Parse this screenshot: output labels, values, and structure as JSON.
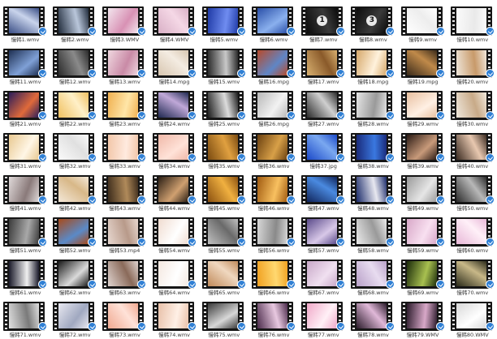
{
  "files": [
    {
      "name": "慢韩1.wmv",
      "colors": [
        "#3a4e86",
        "#c9d4ec"
      ]
    },
    {
      "name": "慢韩2.wmv",
      "colors": [
        "#1f2a3a",
        "#b9c6da"
      ]
    },
    {
      "name": "慢韩3.WMV",
      "colors": [
        "#f3e6ee",
        "#d891b4"
      ]
    },
    {
      "name": "慢韩4.WMV",
      "colors": [
        "#d9b0c6",
        "#f5d8e6"
      ]
    },
    {
      "name": "慢韩5.wmv",
      "colors": [
        "#1f3aa6",
        "#6f8cf0"
      ]
    },
    {
      "name": "慢韩6.wmv",
      "colors": [
        "#2a4fa8",
        "#8ab0ee"
      ]
    },
    {
      "name": "慢韩7.wmv",
      "colors": [
        "#0c0c0c",
        "#3a3a3a"
      ],
      "mark": "1"
    },
    {
      "name": "慢韩8.wmv",
      "colors": [
        "#0c0c0c",
        "#3a3a3a"
      ],
      "mark": "3"
    },
    {
      "name": "慢韩9.wmv",
      "colors": [
        "#ffffff",
        "#ededed"
      ]
    },
    {
      "name": "慢韩10.wmv",
      "colors": [
        "#fbfbfb",
        "#e9e9e9"
      ]
    },
    {
      "name": "慢韩11.wmv",
      "colors": [
        "#1e2f52",
        "#7fa0d6"
      ]
    },
    {
      "name": "慢韩12.wmv",
      "colors": [
        "#2a2a2a",
        "#8a8a8a"
      ]
    },
    {
      "name": "慢韩13.wmv",
      "colors": [
        "#f0d8e0",
        "#c98aa6"
      ]
    },
    {
      "name": "慢韩14.mpg",
      "colors": [
        "#d8c6b0",
        "#f4ece2"
      ]
    },
    {
      "name": "慢韩15.wmv",
      "colors": [
        "#2a2a2a",
        "#c8c8c8"
      ]
    },
    {
      "name": "慢韩16.mpg",
      "colors": [
        "#b84a2a",
        "#5f86c6"
      ]
    },
    {
      "name": "慢韩17.wmv",
      "colors": [
        "#d8b070",
        "#8a5a2a"
      ]
    },
    {
      "name": "慢韩18.mpg",
      "colors": [
        "#d6a86a",
        "#fff2dc"
      ]
    },
    {
      "name": "慢韩19.mpg",
      "colors": [
        "#3a2a1a",
        "#c08a4a"
      ]
    },
    {
      "name": "慢韩20.wmv",
      "colors": [
        "#efe6da",
        "#c89a6a"
      ]
    },
    {
      "name": "慢韩21.wmv",
      "colors": [
        "#2a1c5a",
        "#e06a3a"
      ]
    },
    {
      "name": "慢韩22.wmv",
      "colors": [
        "#f0c060",
        "#fff0c8"
      ]
    },
    {
      "name": "慢韩23.wmv",
      "colors": [
        "#f0b050",
        "#ffe6a8"
      ]
    },
    {
      "name": "慢韩24.wmv",
      "colors": [
        "#1e2850",
        "#c0a8d8"
      ]
    },
    {
      "name": "慢韩25.wmv",
      "colors": [
        "#1a1a1a",
        "#dcdcdc"
      ]
    },
    {
      "name": "慢韩26.mpg",
      "colors": [
        "#b8b8b8",
        "#f2f2f2"
      ]
    },
    {
      "name": "慢韩27.wmv",
      "colors": [
        "#2a2a2a",
        "#cfcfcf"
      ]
    },
    {
      "name": "慢韩28.wmv",
      "colors": [
        "#e6e6e6",
        "#9a9a9a"
      ]
    },
    {
      "name": "慢韩29.wmv",
      "colors": [
        "#e8c0a0",
        "#fff0e4"
      ]
    },
    {
      "name": "慢韩30.wmv",
      "colors": [
        "#f0e8dc",
        "#c8aa88"
      ]
    },
    {
      "name": "慢韩31.wmv",
      "colors": [
        "#e8c890",
        "#fff6e6"
      ]
    },
    {
      "name": "慢韩32.wmv",
      "colors": [
        "#fafafa",
        "#e0e0e0"
      ]
    },
    {
      "name": "慢韩33.wmv",
      "colors": [
        "#f2c6a8",
        "#ffeadf"
      ]
    },
    {
      "name": "慢韩34.wmv",
      "colors": [
        "#f0b8a8",
        "#ffe2d8"
      ]
    },
    {
      "name": "慢韩35.wmv",
      "colors": [
        "#7a4a10",
        "#e0a040"
      ]
    },
    {
      "name": "慢韩36.wmv",
      "colors": [
        "#6a4010",
        "#d8a048"
      ]
    },
    {
      "name": "慢韩37.jpg",
      "colors": [
        "#1a48c8",
        "#7aa8f0"
      ]
    },
    {
      "name": "慢韩38.wmv",
      "colors": [
        "#1a2a7a",
        "#3a78e0"
      ]
    },
    {
      "name": "慢韩39.wmv",
      "colors": [
        "#2a1a14",
        "#c89a7a"
      ]
    },
    {
      "name": "慢韩40.wmv",
      "colors": [
        "#3a2a20",
        "#e8c8b0"
      ]
    },
    {
      "name": "慢韩41.wmv",
      "colors": [
        "#e0dada",
        "#8a7a7a"
      ]
    },
    {
      "name": "慢韩42.wmv",
      "colors": [
        "#f4e8d8",
        "#d8b888"
      ]
    },
    {
      "name": "慢韩43.wmv",
      "colors": [
        "#3a2a1a",
        "#b08a5a"
      ]
    },
    {
      "name": "慢韩44.wmv",
      "colors": [
        "#2a1e14",
        "#d0a070"
      ]
    },
    {
      "name": "慢韩45.wmv",
      "colors": [
        "#8a5010",
        "#f0b040"
      ]
    },
    {
      "name": "慢韩46.wmv",
      "colors": [
        "#a05a10",
        "#f8c060"
      ]
    },
    {
      "name": "慢韩47.wmv",
      "colors": [
        "#10245a",
        "#4a8ae0"
      ]
    },
    {
      "name": "慢韩48.wmv",
      "colors": [
        "#1a2a6a",
        "#e8e8f0"
      ]
    },
    {
      "name": "慢韩49.wmv",
      "colors": [
        "#9a9a9a",
        "#e6e6e6"
      ]
    },
    {
      "name": "慢韩50.wmv",
      "colors": [
        "#2a2a2a",
        "#b8b8b8"
      ]
    },
    {
      "name": "慢韩51.wmv",
      "colors": [
        "#3a3a3a",
        "#a8a8a8"
      ]
    },
    {
      "name": "慢韩52.wmv",
      "colors": [
        "#a84a1a",
        "#5a8ac8"
      ]
    },
    {
      "name": "慢韩53.mp4",
      "colors": [
        "#e8d8d0",
        "#b89a8a"
      ]
    },
    {
      "name": "慢韩54.wmv",
      "colors": [
        "#f0dcd0",
        "#ffffff"
      ]
    },
    {
      "name": "慢韩55.wmv",
      "colors": [
        "#c0c0c0",
        "#6a6a6a"
      ]
    },
    {
      "name": "慢韩56.wmv",
      "colors": [
        "#d8d8d8",
        "#8a8a8a"
      ]
    },
    {
      "name": "慢韩57.wmv",
      "colors": [
        "#5a4a8a",
        "#d8c8e8"
      ]
    },
    {
      "name": "慢韩58.wmv",
      "colors": [
        "#ececec",
        "#9a9a9a"
      ]
    },
    {
      "name": "慢韩59.wmv",
      "colors": [
        "#d8a8c8",
        "#f8e0f0"
      ]
    },
    {
      "name": "慢韩60.wmv",
      "colors": [
        "#e8b8d8",
        "#fff0f8"
      ]
    },
    {
      "name": "慢韩61.wmv",
      "colors": [
        "#1a1a2a",
        "#f0f0f0"
      ]
    },
    {
      "name": "慢韩62.wmv",
      "colors": [
        "#1a1a1a",
        "#dadada"
      ]
    },
    {
      "name": "慢韩63.wmv",
      "colors": [
        "#e0d4d0",
        "#8a6a5a"
      ]
    },
    {
      "name": "慢韩64.wmv",
      "colors": [
        "#f4e8e0",
        "#ffffff"
      ]
    },
    {
      "name": "慢韩65.wmv",
      "colors": [
        "#c08a5a",
        "#f0d8c0"
      ]
    },
    {
      "name": "慢韩66.wmv",
      "colors": [
        "#f0a020",
        "#ffd870"
      ]
    },
    {
      "name": "慢韩67.wmv",
      "colors": [
        "#c8a8c8",
        "#f0e0f0"
      ]
    },
    {
      "name": "慢韩68.wmv",
      "colors": [
        "#b8a0c8",
        "#e8dcf0"
      ]
    },
    {
      "name": "慢韩69.wmv",
      "colors": [
        "#1a2a0a",
        "#a8c050"
      ]
    },
    {
      "name": "慢韩70.wmv",
      "colors": [
        "#2a2a1a",
        "#c8b888"
      ]
    },
    {
      "name": "慢韩71.wmv",
      "colors": [
        "#e0e0e0",
        "#7a7a7a"
      ]
    },
    {
      "name": "慢韩72.wmv",
      "colors": [
        "#e8e8f0",
        "#a0a8c0"
      ]
    },
    {
      "name": "慢韩73.wmv",
      "colors": [
        "#f0a890",
        "#ffe2d8"
      ]
    },
    {
      "name": "慢韩74.wmv",
      "colors": [
        "#e8c0a8",
        "#fff0e6"
      ]
    },
    {
      "name": "慢韩75.wmv",
      "colors": [
        "#3a3a3a",
        "#d8d8d8"
      ]
    },
    {
      "name": "慢韩76.wmv",
      "colors": [
        "#4a2a4a",
        "#e8c8e0"
      ]
    },
    {
      "name": "慢韩77.wmv",
      "colors": [
        "#f0a8c8",
        "#fff0f6"
      ]
    },
    {
      "name": "慢韩78.wmv",
      "colors": [
        "#2a1a2a",
        "#e0b8d8"
      ]
    },
    {
      "name": "慢韩79.WMV",
      "colors": [
        "#2a1a2a",
        "#d8a8c8"
      ]
    },
    {
      "name": "慢韩80.WMV",
      "colors": [
        "#d8d8d8",
        "#ffffff"
      ]
    }
  ],
  "badge_color": "#2f7fd4"
}
